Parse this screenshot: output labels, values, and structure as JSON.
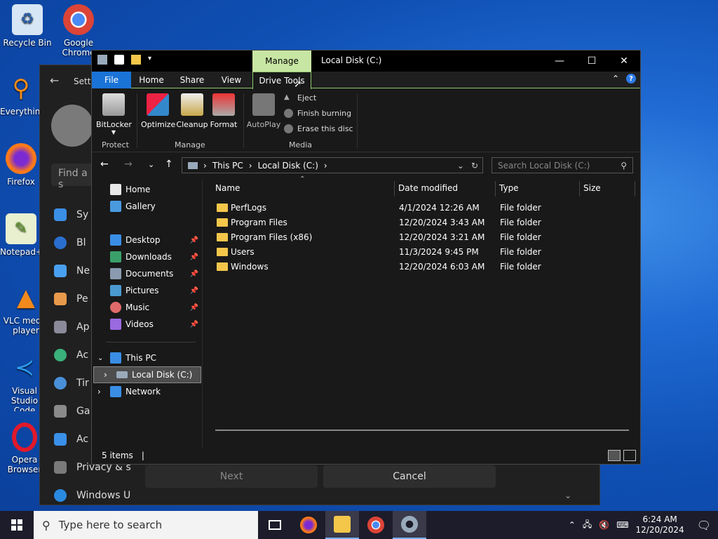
{
  "desktop": {
    "icons": [
      {
        "label": "Recycle Bin"
      },
      {
        "label": "Google Chrome"
      },
      {
        "label": "Everything"
      },
      {
        "label": "Firefox"
      },
      {
        "label": "Notepad++"
      },
      {
        "label": "VLC media player"
      },
      {
        "label": "Visual Studio Code"
      },
      {
        "label": "Opera Browser"
      }
    ]
  },
  "settings": {
    "title": "Setti",
    "search_placeholder": "Find a s",
    "nav": [
      "Sy",
      "Bl",
      "Ne",
      "Pe",
      "Ap",
      "Ac",
      "Tir",
      "Ga",
      "Ac",
      "Privacy & s",
      "Windows U"
    ],
    "next_label": "Next",
    "cancel_label": "Cancel"
  },
  "explorer": {
    "context_tab": "Manage",
    "title": "Local Disk (C:)",
    "tabs": [
      "File",
      "Home",
      "Share",
      "View",
      "Drive Tools"
    ],
    "ribbon": {
      "buttons": [
        "BitLocker",
        "Optimize",
        "Cleanup",
        "Format",
        "AutoPlay"
      ],
      "media_items": [
        "Eject",
        "Finish burning",
        "Erase this disc"
      ],
      "groups": [
        "Protect",
        "Manage",
        "Media"
      ]
    },
    "address": {
      "crumbs": [
        "This PC",
        "Local Disk (C:)"
      ],
      "search_placeholder": "Search Local Disk (C:)"
    },
    "nav": {
      "home": "Home",
      "gallery": "Gallery",
      "quick": [
        "Desktop",
        "Downloads",
        "Documents",
        "Pictures",
        "Music",
        "Videos"
      ],
      "this_pc": "This PC",
      "local_disk": "Local Disk (C:)",
      "network": "Network"
    },
    "columns": [
      "Name",
      "Date modified",
      "Type",
      "Size"
    ],
    "files": [
      {
        "name": "PerfLogs",
        "date": "4/1/2024 12:26 AM",
        "type": "File folder"
      },
      {
        "name": "Program Files",
        "date": "12/20/2024 3:43 AM",
        "type": "File folder"
      },
      {
        "name": "Program Files (x86)",
        "date": "12/20/2024 3:21 AM",
        "type": "File folder"
      },
      {
        "name": "Users",
        "date": "11/3/2024 9:45 PM",
        "type": "File folder"
      },
      {
        "name": "Windows",
        "date": "12/20/2024 6:03 AM",
        "type": "File folder"
      }
    ],
    "status": "5 items"
  },
  "taskbar": {
    "search_placeholder": "Type here to search",
    "time": "6:24 AM",
    "date": "12/20/2024"
  },
  "colors": {
    "file_tab": "#1a73d6",
    "context_tab": "#c8e6a3",
    "folder": "#f4c74b"
  }
}
